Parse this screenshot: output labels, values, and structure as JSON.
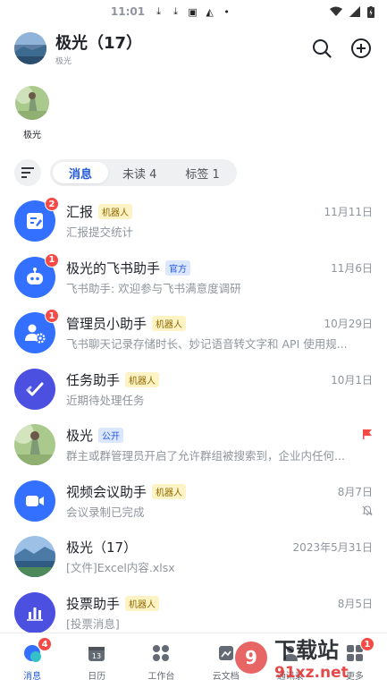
{
  "statusbar": {
    "time": "11:01"
  },
  "header": {
    "title": "极光（17）",
    "subtitle": "极光",
    "search_icon": "search-icon",
    "add_icon": "plus-circle-icon"
  },
  "pinned": {
    "label": "极光"
  },
  "tabs": [
    {
      "label": "消息",
      "active": true
    },
    {
      "label": "未读 4",
      "active": false
    },
    {
      "label": "标签 1",
      "active": false
    }
  ],
  "chats": [
    {
      "title": "汇报",
      "tag": "机器人",
      "tag_type": "bot",
      "time": "11月11日",
      "preview": "汇报提交统计",
      "badge": "2",
      "icon": "report-icon",
      "color": "#3370ff"
    },
    {
      "title": "极光的飞书助手",
      "tag": "官方",
      "tag_type": "official",
      "time": "11月6日",
      "preview": "飞书助手: 欢迎参与飞书满意度调研",
      "badge": "1",
      "icon": "robot-icon",
      "color": "#3370ff"
    },
    {
      "title": "管理员小助手",
      "tag": "机器人",
      "tag_type": "bot",
      "time": "10月29日",
      "preview": "飞书聊天记录存储时长、妙记语音转文字和 API 使用规...",
      "badge": "1",
      "icon": "admin-gear-icon",
      "color": "#3370ff"
    },
    {
      "title": "任务助手",
      "tag": "机器人",
      "tag_type": "bot",
      "time": "10月1日",
      "preview": "近期待处理任务",
      "badge": "",
      "icon": "task-check-icon",
      "color": "#4c50e0"
    },
    {
      "title": "极光",
      "tag": "公开",
      "tag_type": "public",
      "time": "",
      "preview": "群主或群管理员开启了允许群组被搜索到，企业内任何...",
      "badge": "",
      "icon": "photo-avatar",
      "color": "#7fa86a",
      "trail": "red-flag-icon"
    },
    {
      "title": "视频会议助手",
      "tag": "机器人",
      "tag_type": "bot",
      "time": "8月7日",
      "preview": "会议录制已完成",
      "badge": "",
      "icon": "video-camera-icon",
      "color": "#3370ff",
      "trail": "mute-bell-icon"
    },
    {
      "title": "极光（17）",
      "tag": "",
      "tag_type": "",
      "time": "2023年5月31日",
      "preview": "[文件]Excel内容.xlsx",
      "badge": "",
      "icon": "landscape-avatar",
      "color": "#5a86b8"
    },
    {
      "title": "投票助手",
      "tag": "机器人",
      "tag_type": "bot",
      "time": "8月5日",
      "preview": "[投票消息]",
      "badge": "",
      "icon": "poll-chart-icon",
      "color": "#4c50e0"
    }
  ],
  "nav": [
    {
      "label": "消息",
      "icon": "chat-bubble-icon",
      "badge": "4",
      "active": true
    },
    {
      "label": "日历",
      "icon": "calendar-icon",
      "badge": "",
      "active": false
    },
    {
      "label": "工作台",
      "icon": "workbench-grid-icon",
      "badge": "",
      "active": false
    },
    {
      "label": "云文档",
      "icon": "cloud-doc-icon",
      "badge": "",
      "active": false
    },
    {
      "label": "通讯录",
      "icon": "contacts-icon",
      "badge": "",
      "active": false
    },
    {
      "label": "更多",
      "icon": "more-icon",
      "badge": "1",
      "active": false
    }
  ],
  "watermark": {
    "text": "下载站",
    "url": "91xz.net"
  }
}
